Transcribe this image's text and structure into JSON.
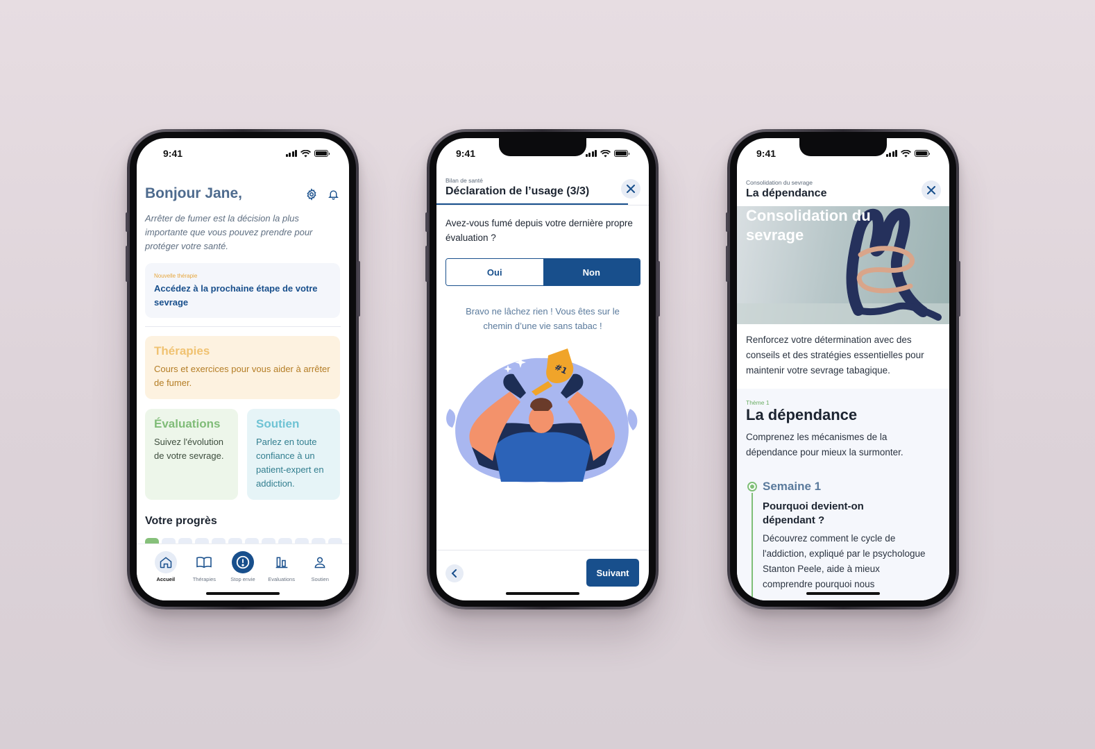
{
  "status_time": "9:41",
  "home": {
    "greeting": "Bonjour Jane,",
    "intro": "Arrêter de fumer est la décision la plus importante que vous pouvez prendre pour protéger votre santé.",
    "next_card": {
      "tag": "Nouvelle thérapie",
      "title": "Accédez à la prochaine étape de votre sevrage"
    },
    "therapies_card": {
      "title": "Thérapies",
      "description": "Cours et exercices pour vous aider à arrêter de fumer."
    },
    "evaluations_card": {
      "title": "Évaluations",
      "description": "Suivez l'évolution de votre sevrage."
    },
    "soutien_card": {
      "title": "Soutien",
      "description": "Parlez en toute confiance à un patient-expert en addiction."
    },
    "progress_title": "Votre progrès",
    "progress": {
      "completed": 1,
      "total": 12
    },
    "tabs": [
      {
        "label": "Accueil",
        "icon": "home-icon",
        "active": true
      },
      {
        "label": "Thérapies",
        "icon": "book-icon",
        "active": false
      },
      {
        "label": "Stop envie",
        "icon": "alert-icon",
        "active": false
      },
      {
        "label": "Evaluations",
        "icon": "chart-icon",
        "active": false
      },
      {
        "label": "Soutien",
        "icon": "user-icon",
        "active": false
      }
    ]
  },
  "survey": {
    "subtitle": "Bilan de santé",
    "title": "Déclaration de l’usage (3/3)",
    "question": "Avez-vous fumé depuis votre dernière propre évaluation ?",
    "option_yes": "Oui",
    "option_no": "Non",
    "selected": "Non",
    "message": "Bravo ne lâchez rien ! Vous êtes sur le chemin d’une vie sans tabac !",
    "trophy_text": "#1",
    "next_label": "Suivant"
  },
  "lesson": {
    "subtitle": "Consolidation du sevrage",
    "title": "La dépendance",
    "hero_title": "Consolidation du sevrage",
    "intro": "Renforcez votre détermination avec des conseils et des stratégies essentielles pour maintenir votre sevrage tabagique.",
    "theme_tag": "Thème 1",
    "theme_title": "La dépendance",
    "theme_description": "Comprenez les mécanismes de la dépendance pour mieux la surmonter.",
    "week": "Semaine 1",
    "lesson_title": "Pourquoi devient-on dépendant ?",
    "lesson_description": "Découvrez comment le cycle de l'addiction, expliqué par le psychologue Stanton Peele, aide à mieux comprendre pourquoi nous"
  },
  "colors": {
    "primary": "#184f8c",
    "heading": "#4e6b8e",
    "therapies": "#f0c271",
    "evaluations": "#80bc78",
    "soutien": "#6fc3d4"
  }
}
